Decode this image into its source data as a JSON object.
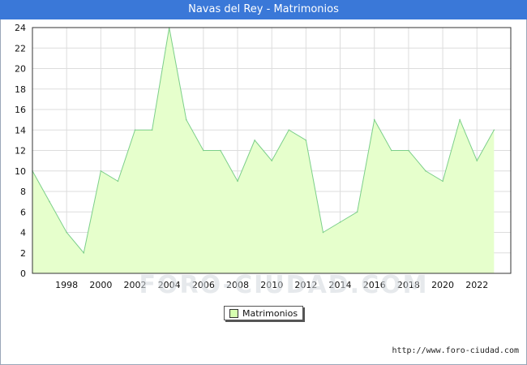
{
  "title": "Navas del Rey - Matrimonios",
  "footer_url": "http://www.foro-ciudad.com",
  "watermark": "FORO-CIUDAD.COM",
  "colors": {
    "title_bg": "#3a78d8",
    "area_fill": "#e6ffcc",
    "line": "#7ccf8a",
    "legend_swatch": "#d6ffb0"
  },
  "chart_data": {
    "type": "area",
    "title": "Navas del Rey - Matrimonios",
    "xlabel": "",
    "ylabel": "",
    "x": [
      1996,
      1997,
      1998,
      1999,
      2000,
      2001,
      2002,
      2003,
      2004,
      2005,
      2006,
      2007,
      2008,
      2009,
      2010,
      2011,
      2012,
      2013,
      2014,
      2015,
      2016,
      2017,
      2018,
      2019,
      2020,
      2021,
      2022,
      2023
    ],
    "series": [
      {
        "name": "Matrimonios",
        "values": [
          10,
          7,
          4,
          2,
          10,
          9,
          14,
          14,
          24,
          15,
          12,
          12,
          9,
          13,
          11,
          14,
          13,
          4,
          5,
          6,
          15,
          12,
          12,
          10,
          9,
          15,
          11,
          14
        ]
      }
    ],
    "xticks": [
      "1998",
      "2000",
      "2002",
      "2004",
      "2006",
      "2008",
      "2010",
      "2012",
      "2014",
      "2016",
      "2018",
      "2020",
      "2022"
    ],
    "yticks": [
      "0",
      "2",
      "4",
      "6",
      "8",
      "10",
      "12",
      "14",
      "16",
      "18",
      "20",
      "22",
      "24"
    ],
    "ylim": [
      0,
      24
    ],
    "grid": true,
    "legend": "bottom-center"
  }
}
